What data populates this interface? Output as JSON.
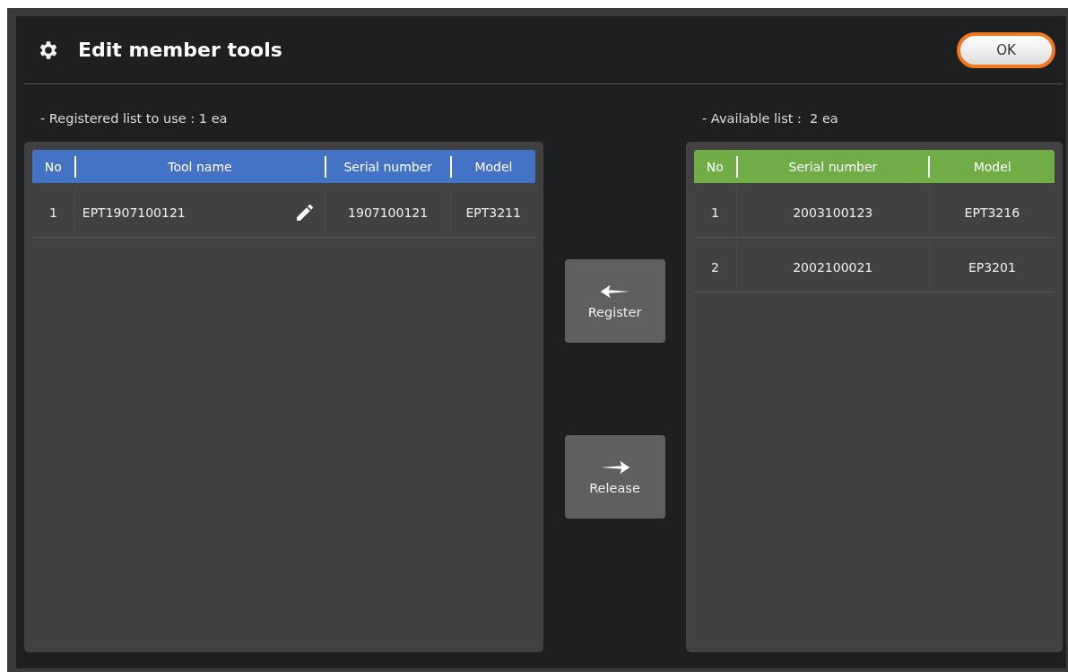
{
  "window": {
    "title": "Edit member tools",
    "ok_button": "OK"
  },
  "registered": {
    "label": "- Registered list to use : 1 ea",
    "columns": [
      "No",
      "Tool name",
      "Serial number",
      "Model"
    ],
    "rows": [
      {
        "no": "1",
        "tool_name": "EPT1907100121",
        "serial": "1907100121",
        "model": "EPT3211"
      }
    ]
  },
  "actions": [
    {
      "label": "Register",
      "kind": "left"
    },
    {
      "label": "Release",
      "kind": "right"
    }
  ],
  "available": {
    "label": "- Available list :  2 ea",
    "columns": [
      "No",
      "Serial number",
      "Model"
    ],
    "rows": [
      {
        "no": "1",
        "serial": "2003100123",
        "model": "EPT3216"
      },
      {
        "no": "2",
        "serial": "2002100021",
        "model": "EP3201"
      }
    ]
  }
}
